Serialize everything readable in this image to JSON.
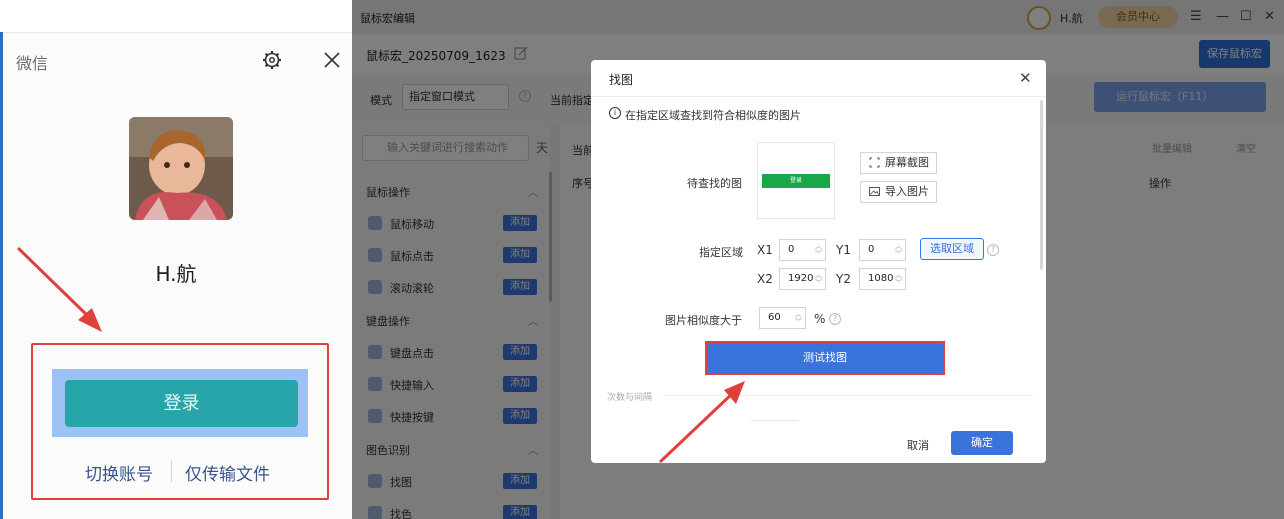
{
  "wechat": {
    "title": "微信",
    "username": "H.航",
    "login_button": "登录",
    "switch_account": "切换账号",
    "transfer_files_only": "仅传输文件"
  },
  "editor": {
    "app_title": "鼠标宏编辑",
    "user_name": "H.航",
    "member_center": "会员中心",
    "window_controls": [
      "☰",
      "—",
      "☐",
      "✕"
    ],
    "macro_name": "鼠标宏_20250709_1623",
    "save_button": "保存鼠标宏",
    "mode_label": "模式",
    "mode_value": "指定窗口模式",
    "current_prefix": "当前指定",
    "run_button": "运行鼠标宏（F11）",
    "search_placeholder": "输入关键词进行搜索动作",
    "filter_icon": "天",
    "groups": [
      {
        "title": "鼠标操作",
        "items": [
          "鼠标移动",
          "鼠标点击",
          "滚动滚轮"
        ]
      },
      {
        "title": "键盘操作",
        "items": [
          "键盘点击",
          "快捷输入",
          "快捷按键"
        ]
      },
      {
        "title": "图色识别",
        "items": [
          "找图",
          "找色"
        ]
      }
    ],
    "add_label": "添加",
    "table": {
      "current_prefix": "当前",
      "col_index": "序号",
      "col_action": "操作"
    },
    "batch_edit": "批量编辑",
    "clear": "清空"
  },
  "dialog": {
    "title": "找图",
    "close": "✕",
    "info": "在指定区域查找到符合相似度的图片",
    "target_label": "待查找的图",
    "screenshot_button": "屏幕截图",
    "import_button": "导入图片",
    "thumb_text": "登录",
    "region_label": "指定区域",
    "x1_label": "X1",
    "x1": "0",
    "y1_label": "Y1",
    "y1": "0",
    "x2_label": "X2",
    "x2": "1920",
    "y2_label": "Y2",
    "y2": "1080",
    "pick_region": "选取区域",
    "similarity_label": "图片相似度大于",
    "similarity": "60",
    "percent": "%",
    "test_button": "测试找图",
    "section": "次数与间隔",
    "cancel": "取消",
    "ok": "确定"
  },
  "colors": {
    "annotation_red": "#e0403a",
    "wechat_login": "#27a5a9",
    "editor_primary": "#3b73dd"
  }
}
